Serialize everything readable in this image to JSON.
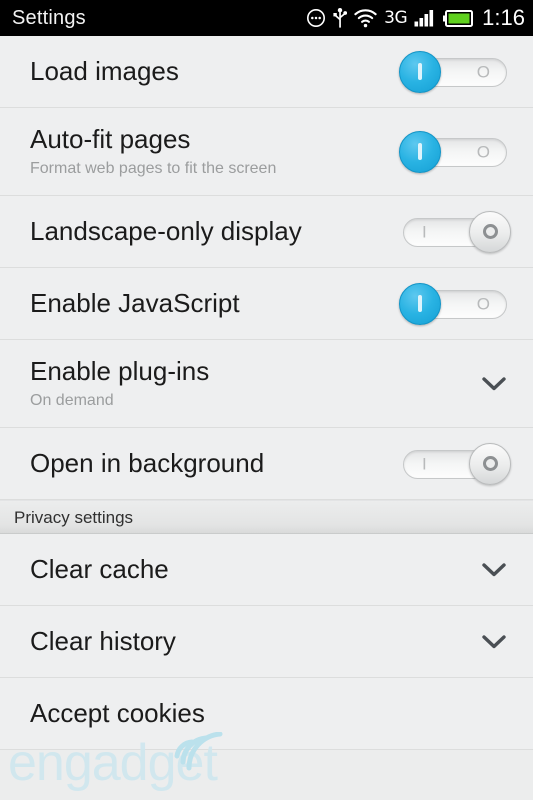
{
  "statusbar": {
    "title": "Settings",
    "clock": "1:16",
    "network_label": "3G",
    "icons": [
      "notifications-overflow-icon",
      "usb-icon",
      "wifi-icon",
      "signal-bars-icon",
      "battery-icon"
    ],
    "battery_color": "#5fd01e",
    "background": "#000000"
  },
  "list": {
    "rows": [
      {
        "title": "Load images",
        "subtitle": "",
        "accessory": "toggle",
        "toggle_state": "on",
        "name": "load-images"
      },
      {
        "title": "Auto-fit pages",
        "subtitle": "Format web pages to fit the screen",
        "accessory": "toggle",
        "toggle_state": "on",
        "name": "auto-fit-pages"
      },
      {
        "title": "Landscape-only display",
        "subtitle": "",
        "accessory": "toggle",
        "toggle_state": "off",
        "name": "landscape-only-display"
      },
      {
        "title": "Enable JavaScript",
        "subtitle": "",
        "accessory": "toggle",
        "toggle_state": "on",
        "name": "enable-javascript"
      },
      {
        "title": "Enable plug-ins",
        "subtitle": "On demand",
        "accessory": "chevron",
        "toggle_state": "",
        "name": "enable-plug-ins"
      },
      {
        "title": "Open in background",
        "subtitle": "",
        "accessory": "toggle",
        "toggle_state": "off",
        "name": "open-in-background"
      }
    ],
    "section_header": {
      "label": "Privacy settings",
      "name": "privacy-settings"
    },
    "privacy_rows": [
      {
        "title": "Clear cache",
        "subtitle": "",
        "accessory": "chevron",
        "toggle_state": "",
        "name": "clear-cache"
      },
      {
        "title": "Clear history",
        "subtitle": "",
        "accessory": "chevron",
        "toggle_state": "",
        "name": "clear-history"
      },
      {
        "title": "Accept cookies",
        "subtitle": "",
        "accessory": "none",
        "toggle_state": "",
        "name": "accept-cookies"
      }
    ]
  },
  "toggle_marks": {
    "on_track": "O",
    "off_track": "I"
  },
  "watermark": {
    "text": "engadget",
    "color": "#cfe7ef"
  },
  "theme": {
    "accent_on": "#29b3e3",
    "row_background": "#eeeff0",
    "divider": "#dcdddd",
    "title_color": "#1b1b1b",
    "subtitle_color": "#9b9d9e"
  }
}
